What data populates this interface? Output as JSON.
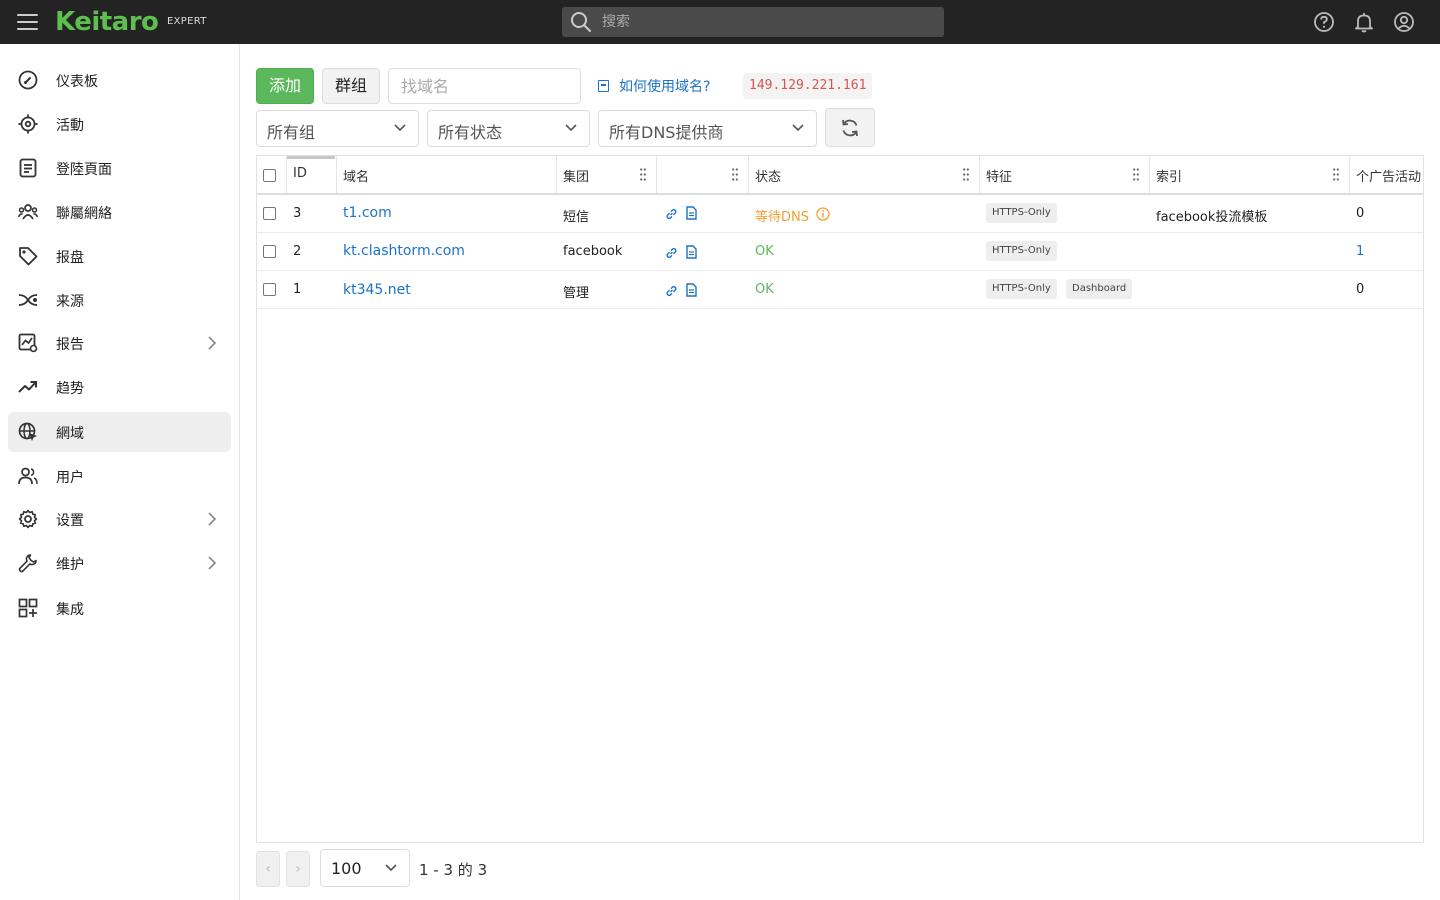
{
  "header": {
    "logo": "Keitaro",
    "edition": "EXPERT",
    "search_placeholder": "搜索"
  },
  "sidebar": {
    "items": [
      {
        "label": "仪表板",
        "icon": "dashboard-icon"
      },
      {
        "label": "活動",
        "icon": "target-icon"
      },
      {
        "label": "登陸頁面",
        "icon": "landing-page-icon"
      },
      {
        "label": "聯屬網絡",
        "icon": "affiliate-network-icon"
      },
      {
        "label": "报盘",
        "icon": "offer-tag-icon"
      },
      {
        "label": "来源",
        "icon": "source-icon"
      },
      {
        "label": "报告",
        "icon": "report-icon"
      },
      {
        "label": "趋势",
        "icon": "trend-icon"
      },
      {
        "label": "網域",
        "icon": "domain-globe-icon"
      },
      {
        "label": "用户",
        "icon": "users-icon"
      },
      {
        "label": "设置",
        "icon": "gear-icon"
      },
      {
        "label": "维护",
        "icon": "wrench-icon"
      },
      {
        "label": "集成",
        "icon": "integration-icon"
      }
    ]
  },
  "toolbar": {
    "add_label": "添加",
    "group_label": "群组",
    "find_placeholder": "找域名",
    "howto_label": "如何使用域名?",
    "ip": "149.129.221.161",
    "filter_group": "所有组",
    "filter_status": "所有状态",
    "filter_dns": "所有DNS提供商"
  },
  "table": {
    "headers": {
      "id": "ID",
      "domain": "域名",
      "group": "集团",
      "status": "状态",
      "features": "特征",
      "index": "索引",
      "campaigns": "个广告活动"
    },
    "rows": [
      {
        "id": "3",
        "domain": "t1.com",
        "group": "短信",
        "status": "等待DNS",
        "features": [
          "HTTPS-Only"
        ],
        "index": "facebook投流模板",
        "campaigns": "0"
      },
      {
        "id": "2",
        "domain": "kt.clashtorm.com",
        "group": "facebook",
        "status": "OK",
        "features": [
          "HTTPS-Only"
        ],
        "index": "",
        "campaigns": "1"
      },
      {
        "id": "1",
        "domain": "kt345.net",
        "group": "管理",
        "status": "OK",
        "features": [
          "HTTPS-Only",
          "Dashboard"
        ],
        "index": "",
        "campaigns": "0"
      }
    ]
  },
  "pagination": {
    "prev": "‹",
    "next": "›",
    "page_size": "100",
    "info": "1 - 3 的 3"
  },
  "colors": {
    "accent": "#5fbe50",
    "link": "#1a73c8",
    "ok": "#5cb85c",
    "warning": "#f0a030",
    "ip": "#d9534f"
  }
}
